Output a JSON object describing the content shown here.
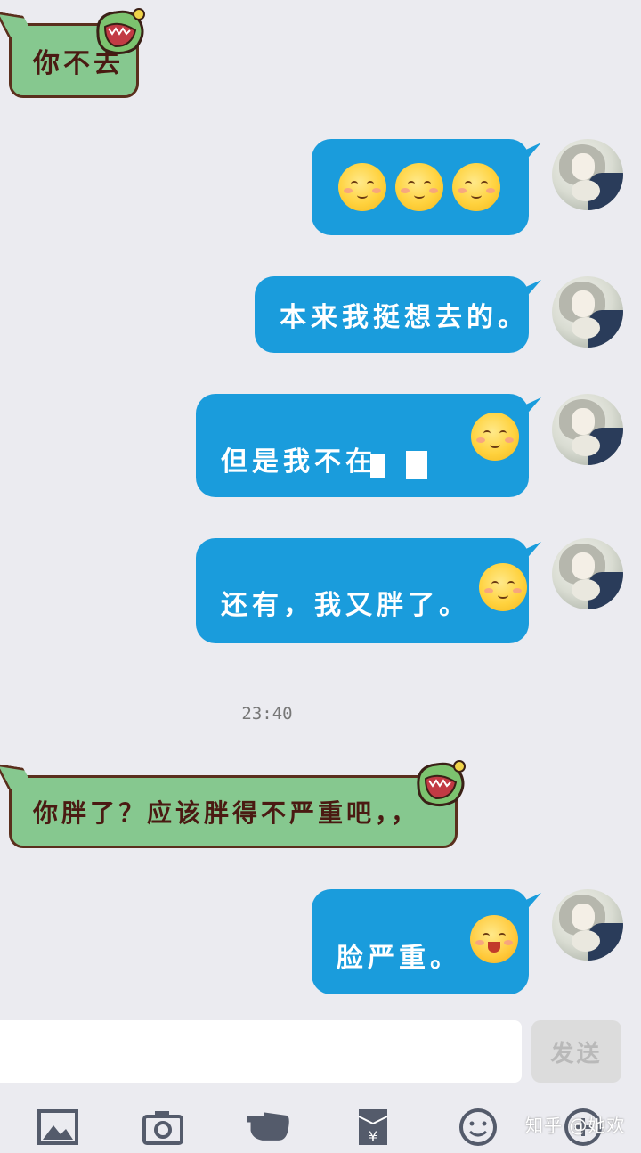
{
  "messages": [
    {
      "side": "in",
      "text": "你不去"
    },
    {
      "side": "out",
      "text": "",
      "emoji_count": 3
    },
    {
      "side": "out",
      "text": "本来我挺想去的。"
    },
    {
      "side": "out",
      "text": "但是我不在",
      "emoji_count": 1
    },
    {
      "side": "out",
      "text": "还有，我又胖了。",
      "emoji_count": 1
    },
    {
      "side": "in",
      "text": "你胖了？应该胖得不严重吧，，"
    },
    {
      "side": "out",
      "text": "脸严重。",
      "emoji_count": 1
    }
  ],
  "timestamp": "23:40",
  "composer": {
    "send_label": "发送",
    "input_value": ""
  },
  "toolbar": {
    "icons": [
      "image-icon",
      "camera-icon",
      "hand-icon",
      "red-envelope-icon",
      "smiley-icon",
      "plus-icon"
    ]
  },
  "watermark": "知乎 @她欢",
  "colors": {
    "outgoing": "#1a9cdc",
    "incoming": "#86c88f",
    "background": "#ebebf0"
  }
}
